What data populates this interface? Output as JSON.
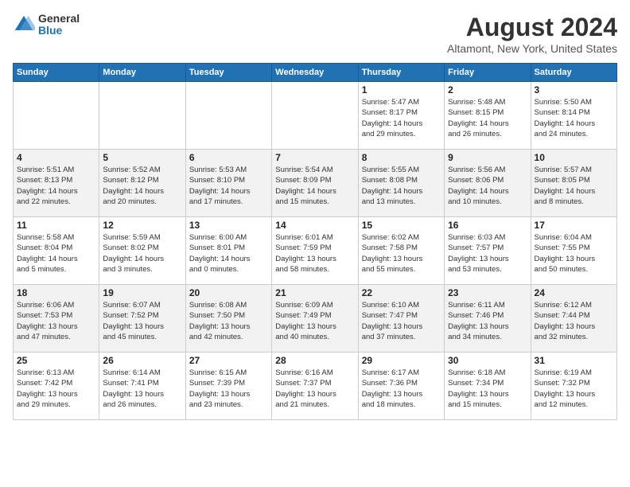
{
  "logo": {
    "general": "General",
    "blue": "Blue"
  },
  "title": "August 2024",
  "subtitle": "Altamont, New York, United States",
  "weekdays": [
    "Sunday",
    "Monday",
    "Tuesday",
    "Wednesday",
    "Thursday",
    "Friday",
    "Saturday"
  ],
  "weeks": [
    [
      {
        "day": "",
        "info": ""
      },
      {
        "day": "",
        "info": ""
      },
      {
        "day": "",
        "info": ""
      },
      {
        "day": "",
        "info": ""
      },
      {
        "day": "1",
        "info": "Sunrise: 5:47 AM\nSunset: 8:17 PM\nDaylight: 14 hours\nand 29 minutes."
      },
      {
        "day": "2",
        "info": "Sunrise: 5:48 AM\nSunset: 8:15 PM\nDaylight: 14 hours\nand 26 minutes."
      },
      {
        "day": "3",
        "info": "Sunrise: 5:50 AM\nSunset: 8:14 PM\nDaylight: 14 hours\nand 24 minutes."
      }
    ],
    [
      {
        "day": "4",
        "info": "Sunrise: 5:51 AM\nSunset: 8:13 PM\nDaylight: 14 hours\nand 22 minutes."
      },
      {
        "day": "5",
        "info": "Sunrise: 5:52 AM\nSunset: 8:12 PM\nDaylight: 14 hours\nand 20 minutes."
      },
      {
        "day": "6",
        "info": "Sunrise: 5:53 AM\nSunset: 8:10 PM\nDaylight: 14 hours\nand 17 minutes."
      },
      {
        "day": "7",
        "info": "Sunrise: 5:54 AM\nSunset: 8:09 PM\nDaylight: 14 hours\nand 15 minutes."
      },
      {
        "day": "8",
        "info": "Sunrise: 5:55 AM\nSunset: 8:08 PM\nDaylight: 14 hours\nand 13 minutes."
      },
      {
        "day": "9",
        "info": "Sunrise: 5:56 AM\nSunset: 8:06 PM\nDaylight: 14 hours\nand 10 minutes."
      },
      {
        "day": "10",
        "info": "Sunrise: 5:57 AM\nSunset: 8:05 PM\nDaylight: 14 hours\nand 8 minutes."
      }
    ],
    [
      {
        "day": "11",
        "info": "Sunrise: 5:58 AM\nSunset: 8:04 PM\nDaylight: 14 hours\nand 5 minutes."
      },
      {
        "day": "12",
        "info": "Sunrise: 5:59 AM\nSunset: 8:02 PM\nDaylight: 14 hours\nand 3 minutes."
      },
      {
        "day": "13",
        "info": "Sunrise: 6:00 AM\nSunset: 8:01 PM\nDaylight: 14 hours\nand 0 minutes."
      },
      {
        "day": "14",
        "info": "Sunrise: 6:01 AM\nSunset: 7:59 PM\nDaylight: 13 hours\nand 58 minutes."
      },
      {
        "day": "15",
        "info": "Sunrise: 6:02 AM\nSunset: 7:58 PM\nDaylight: 13 hours\nand 55 minutes."
      },
      {
        "day": "16",
        "info": "Sunrise: 6:03 AM\nSunset: 7:57 PM\nDaylight: 13 hours\nand 53 minutes."
      },
      {
        "day": "17",
        "info": "Sunrise: 6:04 AM\nSunset: 7:55 PM\nDaylight: 13 hours\nand 50 minutes."
      }
    ],
    [
      {
        "day": "18",
        "info": "Sunrise: 6:06 AM\nSunset: 7:53 PM\nDaylight: 13 hours\nand 47 minutes."
      },
      {
        "day": "19",
        "info": "Sunrise: 6:07 AM\nSunset: 7:52 PM\nDaylight: 13 hours\nand 45 minutes."
      },
      {
        "day": "20",
        "info": "Sunrise: 6:08 AM\nSunset: 7:50 PM\nDaylight: 13 hours\nand 42 minutes."
      },
      {
        "day": "21",
        "info": "Sunrise: 6:09 AM\nSunset: 7:49 PM\nDaylight: 13 hours\nand 40 minutes."
      },
      {
        "day": "22",
        "info": "Sunrise: 6:10 AM\nSunset: 7:47 PM\nDaylight: 13 hours\nand 37 minutes."
      },
      {
        "day": "23",
        "info": "Sunrise: 6:11 AM\nSunset: 7:46 PM\nDaylight: 13 hours\nand 34 minutes."
      },
      {
        "day": "24",
        "info": "Sunrise: 6:12 AM\nSunset: 7:44 PM\nDaylight: 13 hours\nand 32 minutes."
      }
    ],
    [
      {
        "day": "25",
        "info": "Sunrise: 6:13 AM\nSunset: 7:42 PM\nDaylight: 13 hours\nand 29 minutes."
      },
      {
        "day": "26",
        "info": "Sunrise: 6:14 AM\nSunset: 7:41 PM\nDaylight: 13 hours\nand 26 minutes."
      },
      {
        "day": "27",
        "info": "Sunrise: 6:15 AM\nSunset: 7:39 PM\nDaylight: 13 hours\nand 23 minutes."
      },
      {
        "day": "28",
        "info": "Sunrise: 6:16 AM\nSunset: 7:37 PM\nDaylight: 13 hours\nand 21 minutes."
      },
      {
        "day": "29",
        "info": "Sunrise: 6:17 AM\nSunset: 7:36 PM\nDaylight: 13 hours\nand 18 minutes."
      },
      {
        "day": "30",
        "info": "Sunrise: 6:18 AM\nSunset: 7:34 PM\nDaylight: 13 hours\nand 15 minutes."
      },
      {
        "day": "31",
        "info": "Sunrise: 6:19 AM\nSunset: 7:32 PM\nDaylight: 13 hours\nand 12 minutes."
      }
    ]
  ]
}
